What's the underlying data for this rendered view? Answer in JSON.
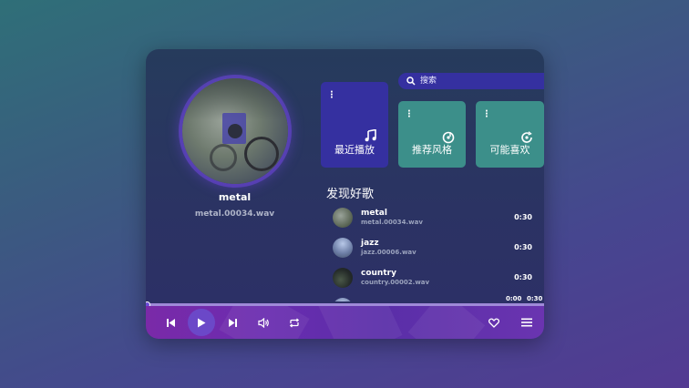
{
  "now_playing": {
    "title": "metal",
    "file": "metal.00034.wav"
  },
  "search": {
    "placeholder": "搜索"
  },
  "tiles": [
    {
      "label": "最近播放",
      "icon": "music-note-icon"
    },
    {
      "label": "推荐风格",
      "icon": "disc-icon"
    },
    {
      "label": "可能喜欢",
      "icon": "refresh-disc-icon"
    }
  ],
  "section_title": "发现好歌",
  "songs": [
    {
      "name": "metal",
      "file": "metal.00034.wav",
      "duration": "0:30"
    },
    {
      "name": "jazz",
      "file": "jazz.00006.wav",
      "duration": "0:30"
    },
    {
      "name": "country",
      "file": "country.00002.wav",
      "duration": "0:30"
    },
    {
      "name": "...",
      "file": "",
      "duration": ""
    }
  ],
  "playback": {
    "current_time": "0:00",
    "total_time": "0:30",
    "progress": 0.0
  },
  "colors": {
    "accent": "#3530a0",
    "tile": "#3c8f8a",
    "bar": "#6a2cb0"
  }
}
